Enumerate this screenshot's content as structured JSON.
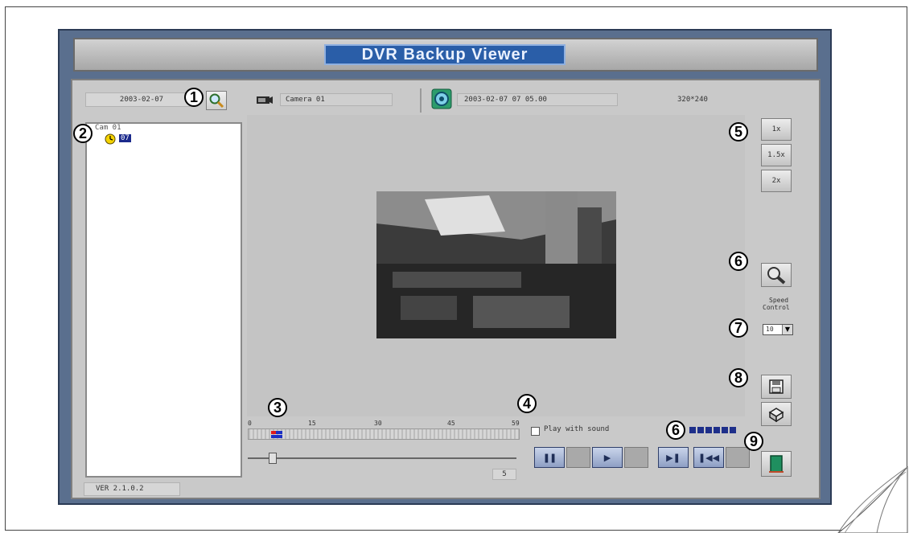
{
  "app": {
    "title": "DVR Backup Viewer",
    "version": "VER 2.1.0.2"
  },
  "search": {
    "date": "2003-02-07"
  },
  "tree": {
    "camera_node": "Cam 01",
    "hour_item": "07"
  },
  "info_bar": {
    "camera_name": "Camera 01",
    "timestamp": "2003-02-07 07 05.00",
    "resolution": "320*240"
  },
  "zoom": {
    "buttons": [
      "1x",
      "1.5x",
      "2x"
    ]
  },
  "speed": {
    "label_line1": "Speed",
    "label_line2": "Control",
    "value": "10"
  },
  "timeline": {
    "ticks": [
      "0",
      "15",
      "30",
      "45",
      "59"
    ],
    "slider_value": "5"
  },
  "sound": {
    "label": "Play with sound",
    "checked": false
  },
  "callouts": [
    "1",
    "2",
    "3",
    "4",
    "5",
    "6",
    "7",
    "8",
    "6",
    "9"
  ],
  "colors": {
    "app_border": "#5a6f8e",
    "title_bg": "#2a5ea8",
    "panel_bg": "#c9c9c9",
    "record_marker_red": "#e11a1a",
    "record_marker_blue": "#1c2fc4",
    "progress_blue": "#1e2f8a"
  },
  "icons": {
    "search": "magnifier-icon",
    "clock": "clock-icon",
    "camera": "camera-icon",
    "cam_status": "camera-status-icon",
    "zoom": "zoom-magnifier-icon",
    "save": "floppy-disk-icon",
    "print": "printer-icon",
    "exit": "exit-door-icon"
  }
}
